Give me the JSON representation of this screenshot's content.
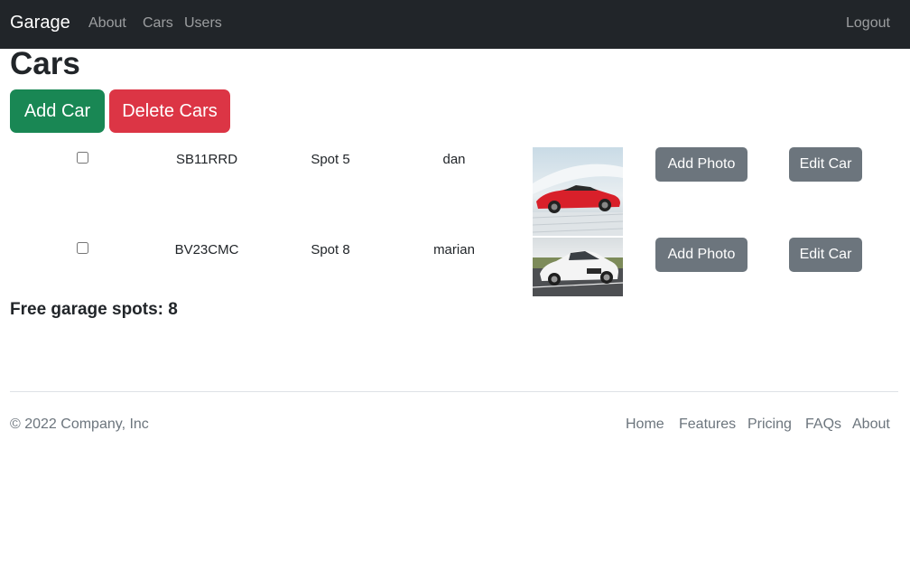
{
  "nav": {
    "brand": "Garage",
    "links": [
      "About",
      "Cars",
      "Users"
    ],
    "logout": "Logout"
  },
  "page": {
    "title": "Cars",
    "add_car_label": "Add Car",
    "delete_cars_label": "Delete Cars"
  },
  "cars": [
    {
      "plate": "SB11RRD",
      "spot": "Spot 5",
      "owner": "dan",
      "photo": "red-sports-car-photo",
      "add_photo_label": "Add Photo",
      "edit_label": "Edit Car"
    },
    {
      "plate": "BV23CMC",
      "spot": "Spot 8",
      "owner": "marian",
      "photo": "white-coupe-car-photo",
      "add_photo_label": "Add Photo",
      "edit_label": "Edit Car"
    }
  ],
  "free_spots": "Free garage spots: 8",
  "footer": {
    "copyright": "© 2022 Company, Inc",
    "links": [
      "Home",
      "Features",
      "Pricing",
      "FAQs",
      "About"
    ]
  },
  "colors": {
    "navbar": "#212529",
    "success": "#198754",
    "danger": "#dc3545",
    "secondary": "#6c757d"
  }
}
